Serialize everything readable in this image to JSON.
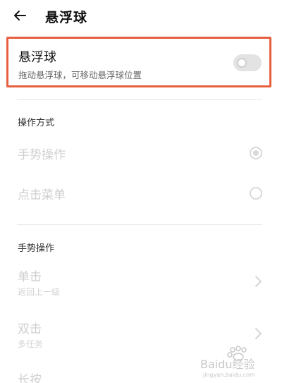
{
  "header": {
    "back_icon": "arrow-left-icon",
    "title": "悬浮球"
  },
  "floating_ball": {
    "title": "悬浮球",
    "description": "拖动悬浮球，可移动悬浮球位置",
    "enabled": false,
    "highlight_color": "#e85f3f"
  },
  "operation_mode": {
    "section_title": "操作方式",
    "options": [
      {
        "label": "手势操作",
        "selected": true
      },
      {
        "label": "点击菜单",
        "selected": false
      }
    ]
  },
  "gesture_operations": {
    "section_title": "手势操作",
    "items": [
      {
        "label": "单击",
        "value": "返回上一级"
      },
      {
        "label": "双击",
        "value": "多任务"
      },
      {
        "label": "长按",
        "value": ""
      }
    ]
  },
  "watermark": {
    "text": "Baidu经验",
    "sub": "jingyan.baidu.com"
  }
}
